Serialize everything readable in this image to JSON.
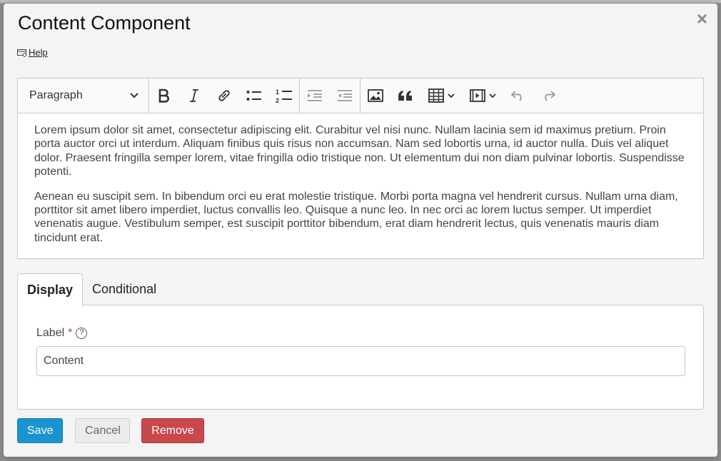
{
  "dialog": {
    "title": "Content Component",
    "close_symbol": "×",
    "help_label": "Help",
    "help_icon": "help-card-icon"
  },
  "editor": {
    "toolbar": {
      "paragraph_label": "Paragraph",
      "buttons": [
        "bold",
        "italic",
        "link",
        "bulleted-list",
        "numbered-list",
        "indent",
        "outdent",
        "image",
        "block-quote",
        "table",
        "media",
        "undo",
        "redo"
      ]
    },
    "paragraphs": [
      "Lorem ipsum dolor sit amet, consectetur adipiscing elit. Curabitur vel nisi nunc. Nullam lacinia sem id maximus pretium. Proin porta auctor orci ut interdum. Aliquam finibus quis risus non accumsan. Nam sed lobortis urna, id auctor nulla. Duis vel aliquet dolor. Praesent fringilla semper lorem, vitae fringilla odio tristique non. Ut elementum dui non diam pulvinar lobortis. Suspendisse potenti.",
      "Aenean eu suscipit sem. In bibendum orci eu erat molestie tristique. Morbi porta magna vel hendrerit cursus. Nullam urna diam, porttitor sit amet libero imperdiet, luctus convallis leo. Quisque a nunc leo. In nec orci ac lorem luctus semper. Ut imperdiet venenatis augue. Vestibulum semper, est suscipit porttitor bibendum, erat diam hendrerit lectus, quis venenatis mauris diam tincidunt erat."
    ]
  },
  "tabs": [
    {
      "label": "Display",
      "active": true
    },
    {
      "label": "Conditional",
      "active": false
    }
  ],
  "label_field": {
    "label": "Label",
    "required_marker": "*",
    "tooltip_symbol": "?",
    "value": "Content"
  },
  "actions": {
    "save": "Save",
    "cancel": "Cancel",
    "remove": "Remove"
  },
  "colors": {
    "save": "#1b93d0",
    "cancel": "#ececec",
    "remove": "#c9484c",
    "required": "#c0392b"
  }
}
